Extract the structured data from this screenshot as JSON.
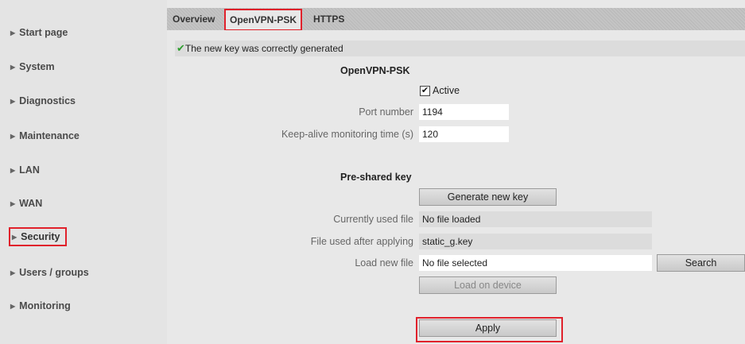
{
  "sidebar": {
    "items": [
      {
        "label": "Start page"
      },
      {
        "label": "System"
      },
      {
        "label": "Diagnostics"
      },
      {
        "label": "Maintenance"
      },
      {
        "label": "LAN"
      },
      {
        "label": "WAN"
      },
      {
        "label": "Security"
      },
      {
        "label": "Users / groups"
      },
      {
        "label": "Monitoring"
      }
    ]
  },
  "tabs": [
    {
      "label": "Overview"
    },
    {
      "label": "OpenVPN-PSK"
    },
    {
      "label": "HTTPS"
    }
  ],
  "message": {
    "icon": "checkmark-icon",
    "text": "The new key was correctly generated"
  },
  "section_title": "OpenVPN-PSK",
  "active": {
    "label": "Active",
    "checked": true
  },
  "port": {
    "label": "Port number",
    "value": "1194"
  },
  "keepalive": {
    "label": "Keep-alive monitoring time (s)",
    "value": "120"
  },
  "psk": {
    "heading": "Pre-shared key",
    "generate_label": "Generate new key",
    "current_label": "Currently used file",
    "current_value": "No file loaded",
    "after_label": "File used after applying",
    "after_value": "static_g.key",
    "load_label": "Load new file",
    "load_value": "No file selected",
    "search_label": "Search",
    "load_device_label": "Load on device"
  },
  "apply_label": "Apply",
  "colors": {
    "highlight": "#e0212b",
    "check": "#2e9e2e"
  }
}
